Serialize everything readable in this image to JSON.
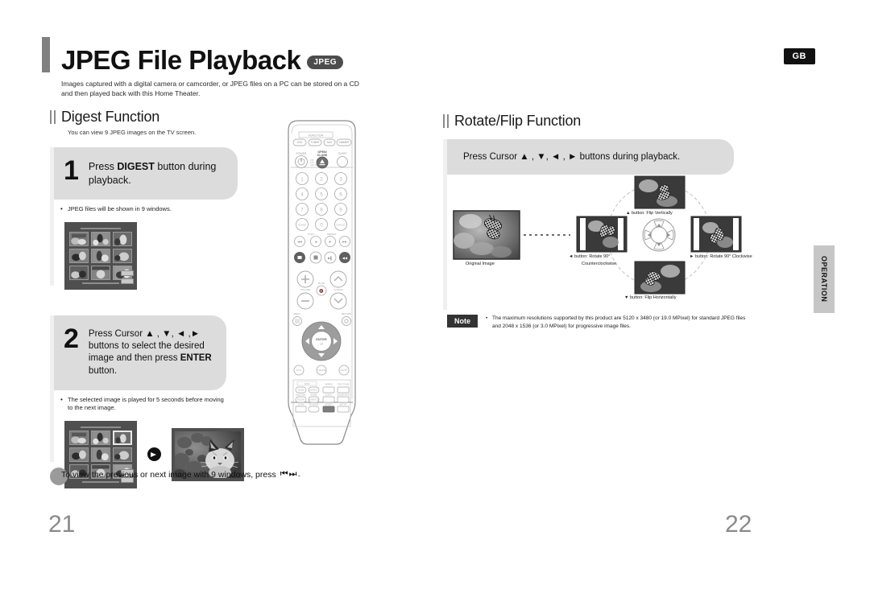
{
  "header": {
    "title": "JPEG File Playback",
    "badge": "JPEG",
    "intro": "Images captured with a digital camera or camcorder, or JPEG files on a PC can be stored on a CD and then played back with this Home Theater.",
    "region_badge": "GB"
  },
  "left": {
    "section_title": "Digest Function",
    "section_sub": "You can view 9 JPEG images on the TV screen.",
    "steps": [
      {
        "number": "1",
        "text_prefix": "Press ",
        "text_bold": "DIGEST",
        "text_suffix": " button during playback.",
        "bullet": "JPEG files will be shown in 9 windows."
      },
      {
        "number": "2",
        "text_prefix": "Press Cursor ▲ , ▼, ◄ ,► buttons to select the desired image and then press ",
        "text_bold": "ENTER",
        "text_suffix": " button.",
        "bullet": "The selected image is played for 5 seconds before moving to the next image."
      }
    ],
    "footnote": "To view the previous or next image with 9 windows, press",
    "footnote_glyph": "⏮ ⏭ ."
  },
  "right": {
    "section_title": "Rotate/Flip Function",
    "callout": "Press Cursor ▲ , ▼, ◄ , ► buttons during playback.",
    "diagram": {
      "original_label": "Original Image",
      "top_label": "▲ button: Flip Vertically",
      "bottom_label": "▼ button: Flip Horizontally",
      "left_label_line1": "◄ button: Rotate 90°",
      "left_label_line2": "Counterclockwise",
      "right_label": "► button: Rotate 90° Clockwise"
    },
    "note_chip": "Note",
    "note_text": "The maximum resolutions supported by this product are 5120 x 3480 (or 19.0 MPixel) for standard JPEG files and 2048 x 1536 (or 3.0 MPixel) for progressive image files."
  },
  "side_tab": "OPERATION",
  "page_numbers": {
    "left": "21",
    "right": "22"
  },
  "remote": {
    "function_label": "FUNCTION",
    "source_buttons": [
      "DVD",
      "TUNER",
      "AUX",
      "DIMMER"
    ],
    "power_label": "POWER",
    "open_close_label": "OPEN/CLOSE",
    "sleep_label": "SLEEP",
    "numbers": [
      "1",
      "2",
      "3",
      "4",
      "5",
      "6",
      "7",
      "8",
      "9"
    ],
    "num_left_label": "SDAMP",
    "num_zero": "0",
    "num_right_label": "CANCEL",
    "step_label": "STEP",
    "repeat_label": "REPEAT",
    "mute_label": "MUTE",
    "volume_label": "VOLUME",
    "tuning_label": "TUNING",
    "menu_label": "MENU",
    "return_label": "RETURN",
    "enter_label": "ENTER",
    "info_label": "INFO",
    "play_mode_label": "P.MODE",
    "mo_st_label": "MO/ST",
    "dvd_group_label": "DVD",
    "grid_labels": [
      "MODE",
      "EFFECT",
      "SERIES",
      "TEST TONE",
      "VIDEO SEL",
      "SLOW",
      "LOGIC",
      "SOUND EDIT",
      "P.SCAN",
      "SUBTITLE",
      "ZOOM",
      "SD MODE",
      "DIGEST",
      "SETUP"
    ]
  },
  "colors": {
    "callout_bg": "#dcdcdc",
    "rule_bg": "#f0f0f0",
    "accent_dark": "#333333",
    "page_number": "#8a8a8a",
    "tab_bg": "#c6c6c6"
  }
}
